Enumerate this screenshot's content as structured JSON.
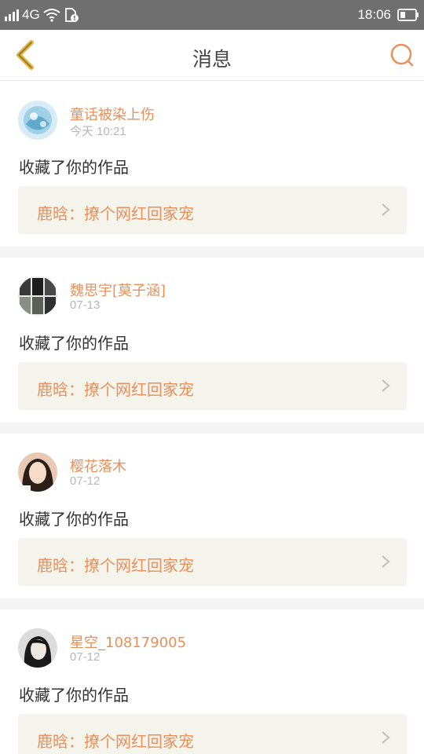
{
  "status_bar": {
    "network": "4G",
    "time": "18:06",
    "icons": [
      "signal-icon",
      "wifi-icon",
      "sim-alert-icon",
      "battery-icon"
    ]
  },
  "header": {
    "title": "消息",
    "back_icon": "chevron-left-icon",
    "search_icon": "search-icon"
  },
  "colors": {
    "accent": "#e8905b",
    "back_icon": "#e4b33c",
    "status_bar": "#6f6f6f",
    "work_card_bg": "#f4f3ec"
  },
  "messages": [
    {
      "username": "童话被染上伤",
      "time": "今天 10:21",
      "action": "收藏了你的作品",
      "work_title": "鹿晗：撩个网红回家宠"
    },
    {
      "username": "魏思宇[莫子涵]",
      "time": "07-13",
      "action": "收藏了你的作品",
      "work_title": "鹿晗：撩个网红回家宠"
    },
    {
      "username": "樱花落木",
      "time": "07-12",
      "action": "收藏了你的作品",
      "work_title": "鹿晗：撩个网红回家宠"
    },
    {
      "username": "星空_108179005",
      "time": "07-12",
      "action": "收藏了你的作品",
      "work_title": "鹿晗：撩个网红回家宠"
    }
  ]
}
